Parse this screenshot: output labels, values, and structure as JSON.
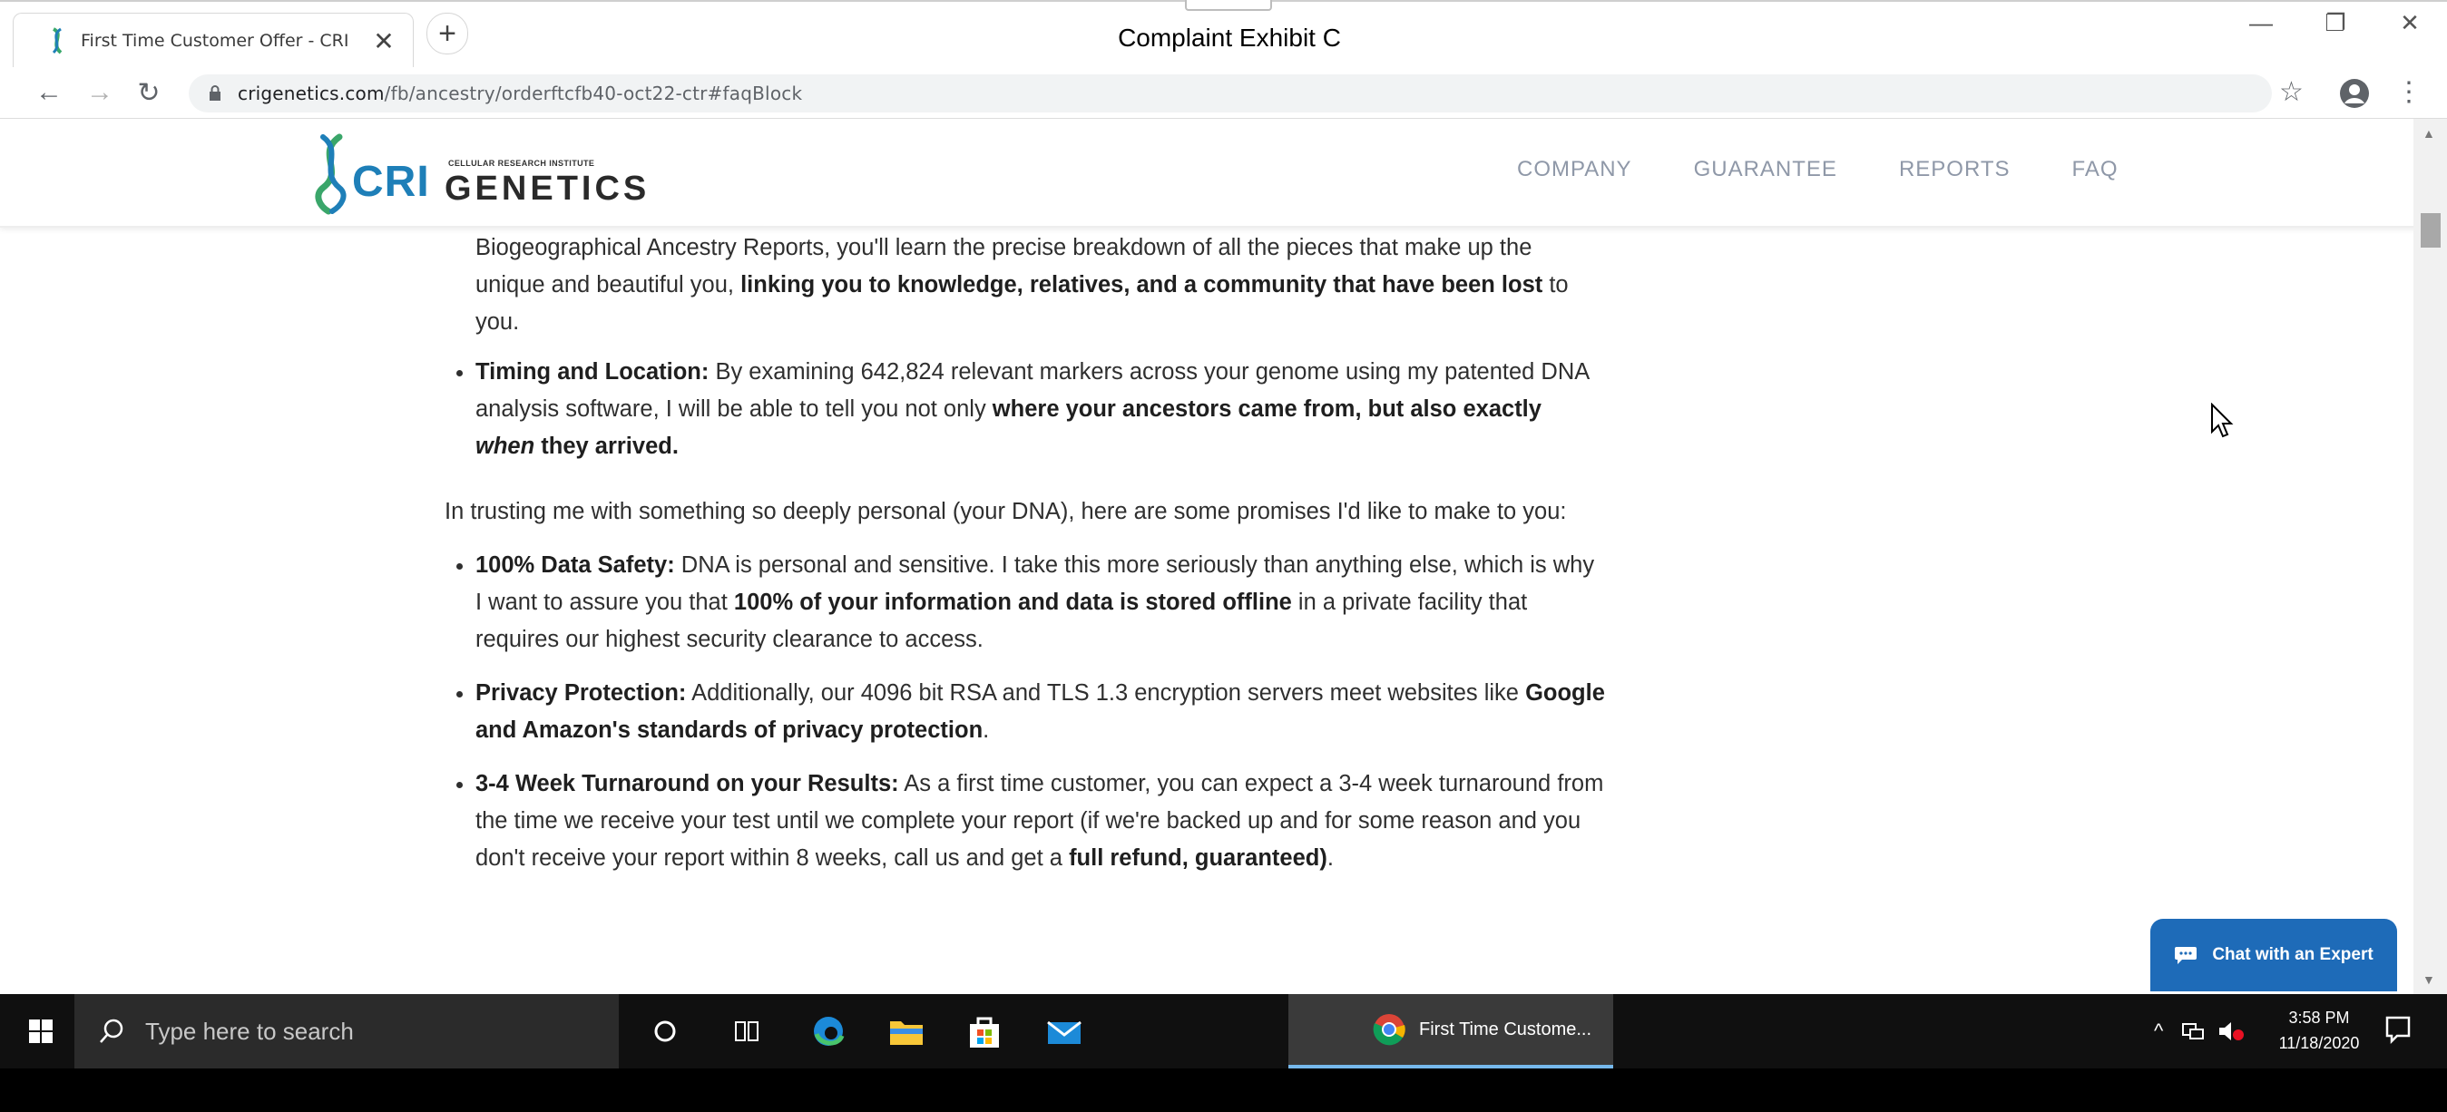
{
  "browser": {
    "tab_title": "First Time Customer Offer - CRI G",
    "tab_close": "✕",
    "new_tab": "+",
    "url_host": "crigenetics.com",
    "url_path": "/fb/ancestry/orderftcfb40-oct22-ctr#faqBlock"
  },
  "exhibit_label": "Complaint Exhibit C",
  "window_controls": {
    "minimize": "—",
    "restore": "❐",
    "close": "✕"
  },
  "site": {
    "logo_cri": "CRI",
    "logo_genetics": "GENETICS",
    "logo_institute": "CELLULAR RESEARCH INSTITUTE",
    "nav": [
      "COMPANY",
      "GUARANTEE",
      "REPORTS",
      "FAQ"
    ]
  },
  "content": {
    "intro_part1": "Biogeographical Ancestry Reports, you'll learn the precise breakdown of all the pieces that make up the unique and beautiful you, ",
    "intro_bold": "linking you to knowledge, relatives, and a community that have been lost",
    "intro_part2": " to you.",
    "timing_label": "Timing and Location:",
    "timing_text": " By examining 642,824 relevant markers across your genome using my patented DNA analysis software, I will be able to tell you not only ",
    "timing_bold1": "where your ancestors came from, but also exactly ",
    "timing_em": "when",
    "timing_bold2": " they arrived.",
    "promise_intro": "In trusting me with something so deeply personal (your DNA), here are some promises I'd like to make to you:",
    "safety_label": "100% Data Safety:",
    "safety_text1": " DNA is personal and sensitive. I take this more seriously than anything else, which is why I want to assure you that ",
    "safety_bold": "100% of your information and data is stored offline",
    "safety_text2": " in a private facility that requires our highest security clearance to access.",
    "privacy_label": "Privacy Protection:",
    "privacy_text1": " Additionally, our 4096 bit RSA and TLS 1.3 encryption servers meet websites like ",
    "privacy_bold": "Google and Amazon's standards of privacy protection",
    "privacy_text2": ".",
    "turnaround_label": "3-4 Week Turnaround on your Results:",
    "turnaround_text": " As a first time customer, you can expect a 3-4 week turnaround from the time we receive your test until we complete your report (if we're backed up and for some reason and you don't receive your report within 8 weeks, call us and get a ",
    "turnaround_bold": "full refund, guaranteed)",
    "turnaround_end": "."
  },
  "chat_button": "Chat with an Expert",
  "taskbar": {
    "search_placeholder": "Type here to search",
    "chrome_task": "First Time Custome...",
    "time": "3:58 PM",
    "date": "11/18/2020"
  },
  "colors": {
    "brand_blue": "#1e7fb8",
    "chat_blue": "#1e6bb8",
    "taskbar": "#101010"
  }
}
